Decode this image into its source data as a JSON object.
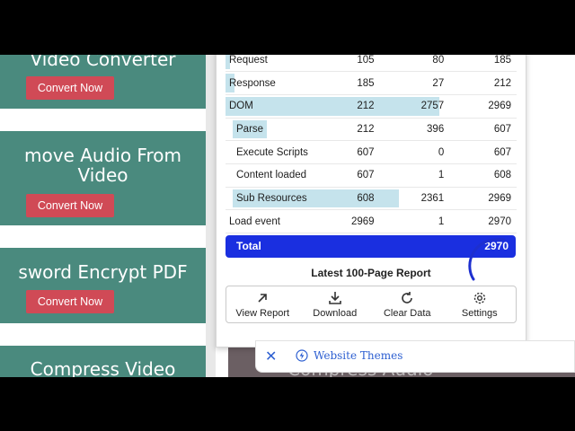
{
  "cards": [
    {
      "title_lines": [
        "Video Converter"
      ],
      "button": "Convert Now"
    },
    {
      "title_lines": [
        "move Audio From",
        "Video"
      ],
      "button": "Convert Now"
    },
    {
      "title_lines": [
        "sword Encrypt PDF"
      ],
      "button": "Convert Now"
    },
    {
      "title_lines": [
        "Compress Video"
      ]
    }
  ],
  "background_text": "Compress Audio",
  "metrics": {
    "rows": [
      {
        "label": "Request",
        "a": "105",
        "b": "80",
        "total": "185",
        "sub": false,
        "bar": 0.02
      },
      {
        "label": "Response",
        "a": "185",
        "b": "27",
        "total": "212",
        "sub": false,
        "bar": 0.04
      },
      {
        "label": "DOM",
        "a": "212",
        "b": "2757",
        "total": "2969",
        "sub": false,
        "bar": 0.95
      },
      {
        "label": "Parse",
        "a": "212",
        "b": "396",
        "total": "607",
        "sub": true,
        "bar": 0.15
      },
      {
        "label": "Execute Scripts",
        "a": "607",
        "b": "0",
        "total": "607",
        "sub": true,
        "bar": 0
      },
      {
        "label": "Content loaded",
        "a": "607",
        "b": "1",
        "total": "608",
        "sub": true,
        "bar": 0
      },
      {
        "label": "Sub Resources",
        "a": "608",
        "b": "2361",
        "total": "2969",
        "sub": true,
        "bar": 0.74
      },
      {
        "label": "Load event",
        "a": "2969",
        "b": "1",
        "total": "2970",
        "sub": false,
        "bar": 0
      }
    ],
    "total_label": "Total",
    "total_value": "2970",
    "accent_color": "#1a2fe0",
    "bar_color": "#c5e3ec"
  },
  "report_title": "Latest 100-Page Report",
  "toolbar": [
    {
      "icon": "arrow-up-right-icon",
      "label": "View Report"
    },
    {
      "icon": "download-icon",
      "label": "Download"
    },
    {
      "icon": "refresh-icon",
      "label": "Clear Data"
    },
    {
      "icon": "gear-icon",
      "label": "Settings"
    }
  ],
  "searchbar": {
    "close_symbol": "✕",
    "link_text": "Website Themes"
  }
}
